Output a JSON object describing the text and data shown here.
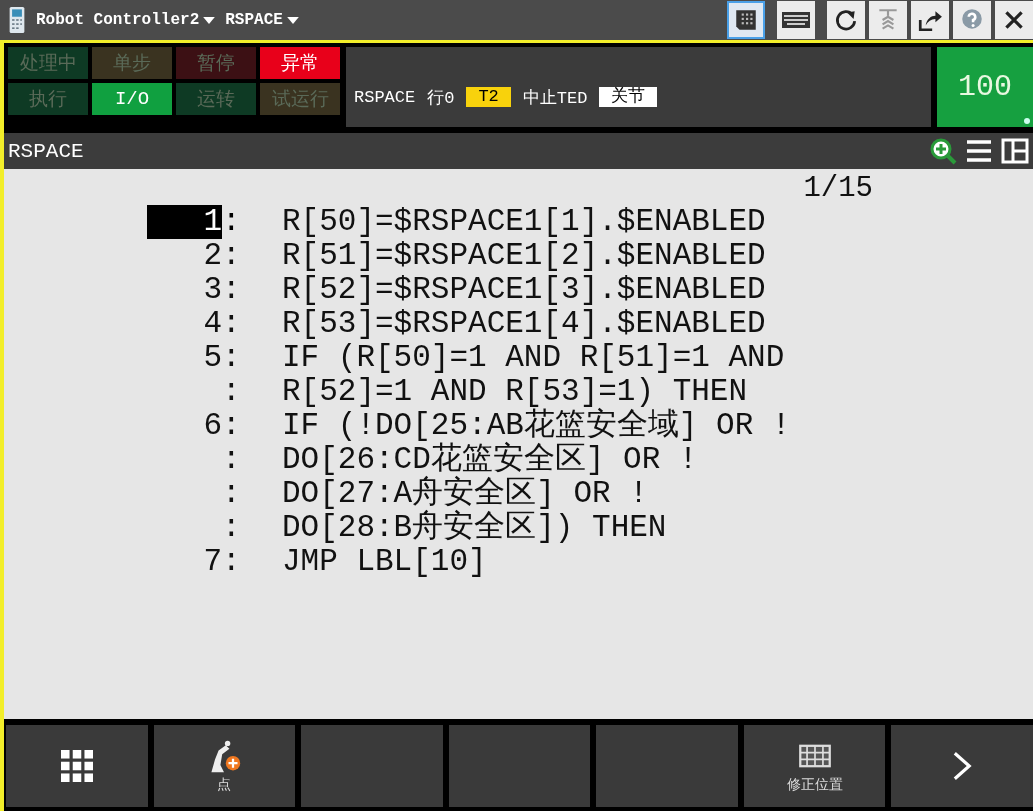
{
  "top_bar": {
    "controller": "Robot Controller2",
    "program": "RSPACE",
    "tools": [
      {
        "kind": "pendant",
        "selected": true
      },
      {
        "kind": "keyboard",
        "selected": false
      },
      {
        "kind": "refresh",
        "selected": false
      },
      {
        "kind": "jog",
        "selected": false
      },
      {
        "kind": "export",
        "selected": false
      },
      {
        "kind": "help",
        "selected": false
      },
      {
        "kind": "close",
        "selected": false
      }
    ]
  },
  "status_lamps": [
    {
      "label": "处理中",
      "on": false,
      "color": "#0e3a24"
    },
    {
      "label": "单步",
      "on": false,
      "color": "#3a3320"
    },
    {
      "label": "暂停",
      "on": false,
      "color": "#3c1014"
    },
    {
      "label": "异常",
      "on": true,
      "color": "#e8001a"
    },
    {
      "label": "执行",
      "on": false,
      "color": "#0e3a24"
    },
    {
      "label": "I/O",
      "on": true,
      "color": "#10a040"
    },
    {
      "label": "运转",
      "on": false,
      "color": "#0e3a24"
    },
    {
      "label": "试运行",
      "on": false,
      "color": "#3a3320"
    }
  ],
  "message": {
    "program": "RSPACE",
    "line": "行0",
    "mode": "T2",
    "state": "中止TED",
    "coord": "关节"
  },
  "override": {
    "value": "100"
  },
  "screen": {
    "title": "RSPACE"
  },
  "program": {
    "position": "1/15",
    "lines": [
      {
        "number": "1",
        "separator": ":",
        "text": "R[50]=$RSPACE1[1].$ENABLED",
        "selected": true
      },
      {
        "number": "2",
        "separator": ":",
        "text": "R[51]=$RSPACE1[2].$ENABLED",
        "selected": false
      },
      {
        "number": "3",
        "separator": ":",
        "text": "R[52]=$RSPACE1[3].$ENABLED",
        "selected": false
      },
      {
        "number": "4",
        "separator": ":",
        "text": "R[53]=$RSPACE1[4].$ENABLED",
        "selected": false
      },
      {
        "number": "5",
        "separator": ":",
        "text": "IF (R[50]=1 AND R[51]=1 AND",
        "selected": false
      },
      {
        "separator": ":",
        "text": "R[52]=1 AND R[53]=1) THEN",
        "selected": false
      },
      {
        "number": "6",
        "separator": ":",
        "text": "IF (!DO[25:AB花篮安全域] OR !",
        "selected": false
      },
      {
        "separator": ":",
        "text": "DO[26:CD花篮安全区] OR !",
        "selected": false
      },
      {
        "separator": ":",
        "text": "DO[27:A舟安全区] OR !",
        "selected": false
      },
      {
        "separator": ":",
        "text": "DO[28:B舟安全区]) THEN",
        "selected": false
      },
      {
        "number": "7",
        "separator": ":",
        "text": "JMP LBL[10]",
        "selected": false
      }
    ]
  },
  "function_keys": [
    {
      "kind": "menu"
    },
    {
      "kind": "point",
      "label": "点"
    },
    {
      "kind": "empty"
    },
    {
      "kind": "empty"
    },
    {
      "kind": "empty"
    },
    {
      "kind": "touchup",
      "label": "修正位置"
    },
    {
      "kind": "next"
    }
  ]
}
